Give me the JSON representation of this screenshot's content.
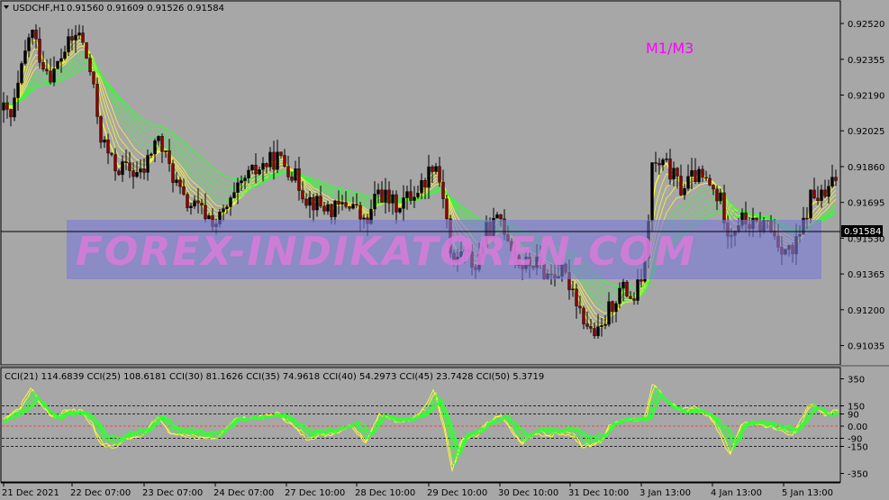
{
  "header": {
    "symbol": "USDCHF,H1",
    "ohlc": "0.91560 0.91609 0.91526 0.91584"
  },
  "timeframe_label": "M1/M3",
  "watermark": "FOREX-INDIKATOREN.COM",
  "current_price_label": "0.91584",
  "price_axis": [
    "0.92520",
    "0.92355",
    "0.92190",
    "0.92025",
    "0.91860",
    "0.91695",
    "0.91530",
    "0.91365",
    "0.91200",
    "0.91035"
  ],
  "indicator_header": "CCI(21) 114.6839  CCI(25) 108.6181  CCI(30) 81.1626  CCI(35) 74.9618  CCI(40) 54.2973  CCI(45) 23.7428  CCI(50) 5.3719",
  "indicator_axis": [
    "350",
    "150",
    "90",
    "0.00",
    "-90",
    "-150",
    "-350"
  ],
  "time_axis": [
    "21 Dec 2021",
    "22 Dec 07:00",
    "23 Dec 07:00",
    "24 Dec 07:00",
    "27 Dec 10:00",
    "28 Dec 10:00",
    "29 Dec 10:00",
    "30 Dec 10:00",
    "31 Dec 10:00",
    "3 Jan 13:00",
    "4 Jan 13:00",
    "5 Jan 13:00"
  ],
  "colors": {
    "background": "#a7a7a7",
    "bull_candle": "#000000",
    "bear_candle": "#8b0000",
    "ma_fast": "#ffff33",
    "ma_slow": "#33ff33",
    "timeframe_label": "#ff00ff",
    "watermark_band": "#7b7bd8",
    "watermark_text": "#d97ad9",
    "zero_line": "#ff3333",
    "current_price_line": "#000000"
  },
  "chart_data": {
    "type": "candlestick",
    "title": "USDCHF,H1",
    "ylim": [
      0.9095,
      0.9262
    ],
    "price_path": [
      [
        0,
        0.9214
      ],
      [
        12,
        0.9208
      ],
      [
        22,
        0.9226
      ],
      [
        34,
        0.925
      ],
      [
        46,
        0.9235
      ],
      [
        58,
        0.9228
      ],
      [
        72,
        0.924
      ],
      [
        88,
        0.9248
      ],
      [
        100,
        0.923
      ],
      [
        112,
        0.92
      ],
      [
        126,
        0.9186
      ],
      [
        140,
        0.9185
      ],
      [
        158,
        0.9182
      ],
      [
        174,
        0.92
      ],
      [
        188,
        0.9186
      ],
      [
        204,
        0.917
      ],
      [
        222,
        0.9166
      ],
      [
        240,
        0.916
      ],
      [
        258,
        0.917
      ],
      [
        272,
        0.918
      ],
      [
        290,
        0.9186
      ],
      [
        308,
        0.919
      ],
      [
        322,
        0.9185
      ],
      [
        340,
        0.9172
      ],
      [
        356,
        0.9168
      ],
      [
        372,
        0.9166
      ],
      [
        390,
        0.917
      ],
      [
        406,
        0.9158
      ],
      [
        420,
        0.9175
      ],
      [
        438,
        0.9168
      ],
      [
        454,
        0.9172
      ],
      [
        470,
        0.9178
      ],
      [
        482,
        0.919
      ],
      [
        494,
        0.917
      ],
      [
        502,
        0.9138
      ],
      [
        512,
        0.9148
      ],
      [
        528,
        0.914
      ],
      [
        540,
        0.9156
      ],
      [
        556,
        0.9162
      ],
      [
        568,
        0.915
      ],
      [
        578,
        0.914
      ],
      [
        594,
        0.9142
      ],
      [
        608,
        0.9136
      ],
      [
        622,
        0.9138
      ],
      [
        636,
        0.913
      ],
      [
        646,
        0.9118
      ],
      [
        656,
        0.911
      ],
      [
        666,
        0.9108
      ],
      [
        676,
        0.912
      ],
      [
        690,
        0.913
      ],
      [
        704,
        0.9125
      ],
      [
        716,
        0.914
      ],
      [
        724,
        0.9186
      ],
      [
        740,
        0.9186
      ],
      [
        756,
        0.9176
      ],
      [
        772,
        0.9182
      ],
      [
        786,
        0.9178
      ],
      [
        800,
        0.917
      ],
      [
        810,
        0.9155
      ],
      [
        822,
        0.9162
      ],
      [
        838,
        0.9158
      ],
      [
        852,
        0.916
      ],
      [
        866,
        0.915
      ],
      [
        880,
        0.9146
      ],
      [
        890,
        0.9156
      ],
      [
        900,
        0.9172
      ],
      [
        916,
        0.9172
      ],
      [
        932,
        0.9184
      ]
    ],
    "indicator": {
      "type": "line",
      "name": "CCI",
      "ylim": [
        -380,
        380
      ],
      "levels": [
        150,
        90,
        0,
        -90,
        -150
      ],
      "series": [
        {
          "name": "CCI(21)",
          "value": 114.6839
        },
        {
          "name": "CCI(25)",
          "value": 108.6181
        },
        {
          "name": "CCI(30)",
          "value": 81.1626
        },
        {
          "name": "CCI(35)",
          "value": 74.9618
        },
        {
          "name": "CCI(40)",
          "value": 54.2973
        },
        {
          "name": "CCI(45)",
          "value": 23.7428
        },
        {
          "name": "CCI(50)",
          "value": 5.3719
        }
      ],
      "cci_path": [
        [
          0,
          40
        ],
        [
          12,
          110
        ],
        [
          22,
          150
        ],
        [
          34,
          300
        ],
        [
          46,
          170
        ],
        [
          58,
          80
        ],
        [
          72,
          120
        ],
        [
          88,
          130
        ],
        [
          100,
          40
        ],
        [
          112,
          -120
        ],
        [
          126,
          -150
        ],
        [
          140,
          -80
        ],
        [
          158,
          -60
        ],
        [
          174,
          90
        ],
        [
          188,
          -40
        ],
        [
          204,
          -60
        ],
        [
          222,
          -80
        ],
        [
          240,
          -90
        ],
        [
          258,
          60
        ],
        [
          272,
          70
        ],
        [
          290,
          80
        ],
        [
          308,
          110
        ],
        [
          322,
          30
        ],
        [
          340,
          -80
        ],
        [
          356,
          -60
        ],
        [
          372,
          -40
        ],
        [
          390,
          20
        ],
        [
          406,
          -110
        ],
        [
          420,
          100
        ],
        [
          438,
          50
        ],
        [
          454,
          60
        ],
        [
          470,
          140
        ],
        [
          482,
          280
        ],
        [
          494,
          -40
        ],
        [
          502,
          -330
        ],
        [
          512,
          -100
        ],
        [
          528,
          -60
        ],
        [
          540,
          30
        ],
        [
          556,
          90
        ],
        [
          568,
          -30
        ],
        [
          578,
          -120
        ],
        [
          594,
          -40
        ],
        [
          608,
          -60
        ],
        [
          622,
          -40
        ],
        [
          636,
          -60
        ],
        [
          646,
          -150
        ],
        [
          656,
          -130
        ],
        [
          666,
          -110
        ],
        [
          676,
          20
        ],
        [
          690,
          60
        ],
        [
          704,
          60
        ],
        [
          716,
          80
        ],
        [
          724,
          330
        ],
        [
          740,
          200
        ],
        [
          756,
          130
        ],
        [
          772,
          150
        ],
        [
          786,
          90
        ],
        [
          800,
          -50
        ],
        [
          810,
          -220
        ],
        [
          822,
          20
        ],
        [
          838,
          30
        ],
        [
          852,
          10
        ],
        [
          866,
          -20
        ],
        [
          880,
          -50
        ],
        [
          890,
          60
        ],
        [
          900,
          190
        ],
        [
          916,
          100
        ],
        [
          932,
          130
        ]
      ]
    }
  }
}
